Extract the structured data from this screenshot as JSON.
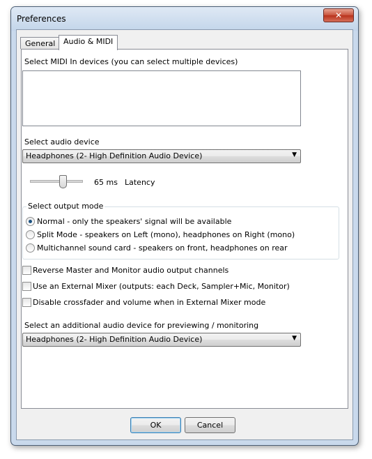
{
  "window": {
    "title": "Preferences",
    "close_glyph": "✕"
  },
  "tabs": [
    {
      "label": "General"
    },
    {
      "label": "Audio & MIDI"
    }
  ],
  "midi": {
    "label": "Select MIDI In devices (you can select multiple devices)"
  },
  "audio_device": {
    "label": "Select audio device",
    "selected": "Headphones (2- High Definition Audio Device)",
    "arrow": "▼"
  },
  "latency": {
    "value": "65 ms",
    "label": "Latency"
  },
  "output_mode": {
    "title": "Select output mode",
    "options": [
      {
        "label": "Normal - only the speakers' signal will be available",
        "checked": true
      },
      {
        "label": "Split Mode - speakers on Left (mono), headphones on Right (mono)",
        "checked": false
      },
      {
        "label": "Multichannel sound card - speakers on front, headphones on rear",
        "checked": false
      }
    ]
  },
  "checkboxes": [
    {
      "label": "Reverse Master and Monitor audio output channels",
      "checked": false
    },
    {
      "label": "Use an External Mixer (outputs: each Deck, Sampler+Mic, Monitor)",
      "checked": false
    },
    {
      "label": "Disable crossfader and volume when in External Mixer mode",
      "checked": false
    }
  ],
  "preview_device": {
    "label": "Select an additional audio device for previewing / monitoring",
    "selected": "Headphones (2- High Definition Audio Device)",
    "arrow": "▼"
  },
  "buttons": {
    "ok": "OK",
    "cancel": "Cancel"
  }
}
